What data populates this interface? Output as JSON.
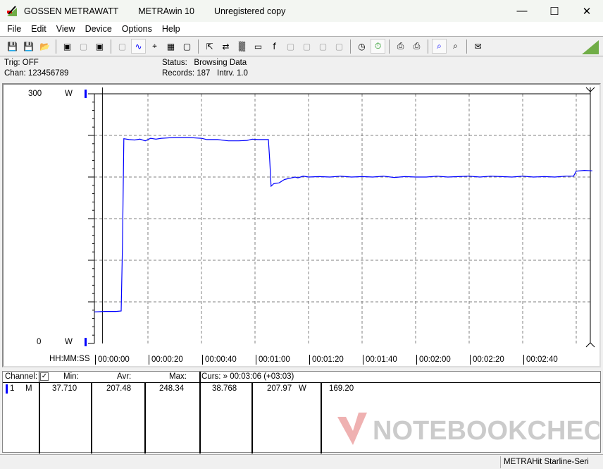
{
  "window": {
    "title_parts": [
      "GOSSEN METRAWATT",
      "METRAwin 10",
      "Unregistered copy"
    ]
  },
  "menu": [
    "File",
    "Edit",
    "View",
    "Device",
    "Options",
    "Help"
  ],
  "toolbar_icons": [
    "save-icon",
    "save-as-icon",
    "open-folder-icon",
    "device-read-icon",
    "device-read-disabled-icon",
    "memory-read-icon",
    "display-disabled-icon",
    "waveform-view-icon",
    "cursor-crosshair-icon",
    "table-view-icon",
    "bar-view-icon",
    "export-icon",
    "transfer-icon",
    "logger-icon",
    "monitor-icon",
    "function-icon",
    "device-disabled-icon",
    "trigger-disabled-icon",
    "waveform-disabled-icon",
    "waveform-grid-disabled-icon",
    "clock-schedule-icon",
    "stopwatch-icon",
    "print-preview-icon",
    "print-icon",
    "zoom-waveform-icon",
    "zoom-peak-icon",
    "comment-icon"
  ],
  "info": {
    "trig": "Trig: OFF",
    "chan": "Chan:  123456789",
    "status_label": "Status:",
    "status_value": "Browsing Data",
    "records": "Records: 187",
    "interval": "Intrv. 1.0"
  },
  "colors": {
    "trace": "#0000ff",
    "grid": "#808080",
    "accent": "#70ad47"
  },
  "chart_data": {
    "type": "line",
    "ylabel_unit": "W",
    "ylim": [
      0,
      300
    ],
    "ytick_labels": [
      "300",
      "0"
    ],
    "xlabel": "HH:MM:SS",
    "xtick_labels": [
      "00:00:00",
      "00:00:20",
      "00:00:40",
      "00:01:00",
      "00:01:20",
      "00:01:40",
      "00:02:00",
      "00:02:20",
      "00:02:40"
    ],
    "xlim_seconds": [
      0,
      186
    ],
    "grid": true,
    "cursor_seconds": 3,
    "series": [
      {
        "points": [
          [
            0,
            38
          ],
          [
            4,
            38.5
          ],
          [
            8,
            38.5
          ],
          [
            10,
            39
          ],
          [
            10.5,
            120
          ],
          [
            11,
            246
          ],
          [
            13,
            245
          ],
          [
            15,
            244.5
          ],
          [
            17,
            245.5
          ],
          [
            19,
            243.5
          ],
          [
            21,
            246.5
          ],
          [
            23,
            245.5
          ],
          [
            25,
            246.5
          ],
          [
            30,
            247.5
          ],
          [
            35,
            247.5
          ],
          [
            40,
            246.5
          ],
          [
            42,
            245
          ],
          [
            46,
            245
          ],
          [
            50,
            243.5
          ],
          [
            54,
            243.5
          ],
          [
            57,
            244
          ],
          [
            59,
            245.5
          ],
          [
            61,
            245
          ],
          [
            63,
            245
          ],
          [
            65,
            245
          ],
          [
            65.5,
            220
          ],
          [
            66,
            189
          ],
          [
            67,
            192
          ],
          [
            69,
            193
          ],
          [
            71,
            197
          ],
          [
            73,
            198.5
          ],
          [
            75,
            200
          ],
          [
            76,
            199
          ],
          [
            78,
            201
          ],
          [
            80,
            200
          ],
          [
            84,
            200.5
          ],
          [
            88,
            200
          ],
          [
            92,
            201
          ],
          [
            96,
            200
          ],
          [
            100,
            200.5
          ],
          [
            104,
            200
          ],
          [
            108,
            201
          ],
          [
            112,
            199.5
          ],
          [
            116,
            200.5
          ],
          [
            120,
            200
          ],
          [
            124,
            200
          ],
          [
            128,
            201
          ],
          [
            132,
            200
          ],
          [
            136,
            200.5
          ],
          [
            140,
            201
          ],
          [
            144,
            200
          ],
          [
            148,
            201
          ],
          [
            152,
            200.5
          ],
          [
            156,
            200
          ],
          [
            160,
            201
          ],
          [
            164,
            200
          ],
          [
            168,
            200.5
          ],
          [
            172,
            200
          ],
          [
            176,
            201
          ],
          [
            179,
            201
          ],
          [
            180,
            207
          ],
          [
            183,
            208
          ],
          [
            186,
            207.5
          ]
        ]
      }
    ]
  },
  "table": {
    "headers": {
      "channel": "Channel:",
      "min": "Min:",
      "avr": "Avr:",
      "max": "Max:",
      "cursor": "Curs: » 00:03:06 (+03:03)"
    },
    "rows": [
      {
        "channel": "1",
        "mode": "M",
        "min": "37.710",
        "avr": "207.48",
        "max": "248.34",
        "curs_value": "38.768",
        "curs_avr": "207.97",
        "unit": "W",
        "extra": "169.20"
      }
    ]
  },
  "statusbar": {
    "device": "METRAHit Starline-Seri"
  },
  "watermark": "NOTEBOOKCHECK"
}
